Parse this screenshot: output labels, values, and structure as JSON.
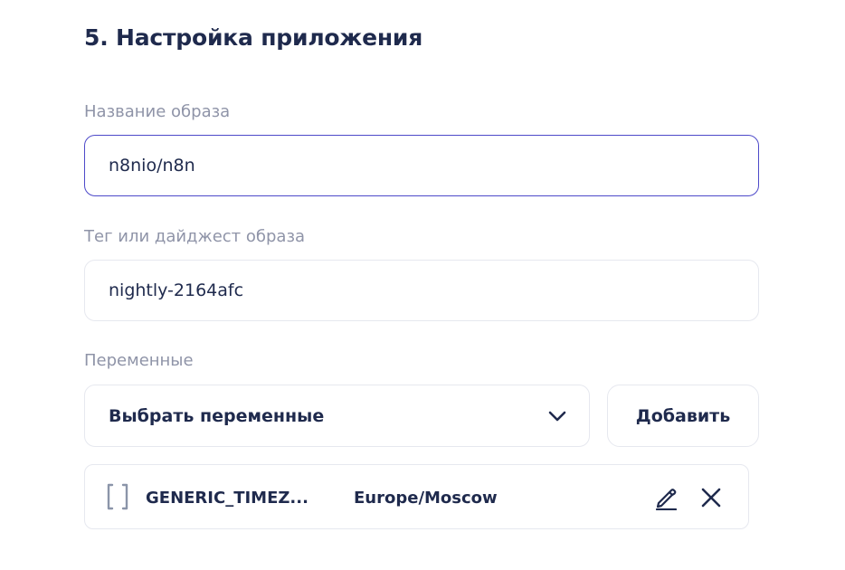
{
  "section": {
    "title": "5. Настройка приложения"
  },
  "image_name": {
    "label": "Название образа",
    "value": "n8nio/n8n"
  },
  "image_tag": {
    "label": "Тег или дайджест образа",
    "value": "nightly-2164afc"
  },
  "variables": {
    "label": "Переменные",
    "select_placeholder": "Выбрать переменные",
    "add_label": "Добавить",
    "items": [
      {
        "key": "GENERIC_TIMEZ...",
        "value": "Europe/Moscow",
        "icon": "brackets-icon",
        "edit_icon": "pencil-icon",
        "remove_icon": "close-icon"
      }
    ]
  },
  "colors": {
    "text_primary": "#1f2a4d",
    "text_muted": "#8f94a8",
    "border": "#e6e8ef",
    "focus_border": "#4d49c9",
    "icon_muted": "#8b95a9"
  }
}
